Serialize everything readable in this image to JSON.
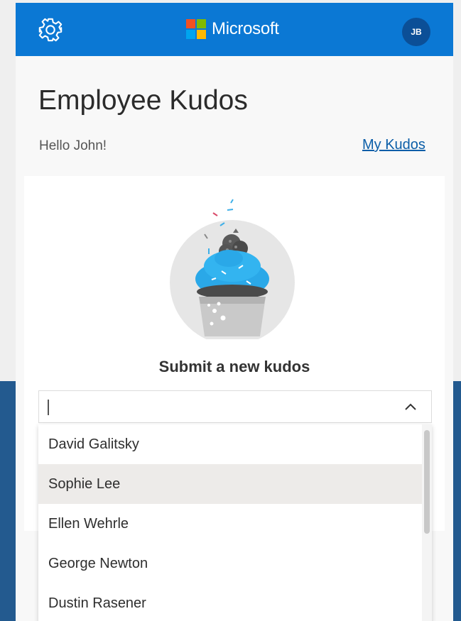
{
  "header": {
    "brand": "Microsoft",
    "avatar_initials": "JB",
    "settings_icon": "gear-icon",
    "colors": {
      "bar": "#0b78d4",
      "avatar": "#0b4f97"
    }
  },
  "page": {
    "title": "Employee Kudos",
    "greeting": "Hello John!",
    "my_kudos_link": "My Kudos"
  },
  "card": {
    "illustration": "cupcake-illustration",
    "heading": "Submit a new kudos"
  },
  "combobox": {
    "value": "",
    "placeholder": "",
    "expanded": true,
    "options": [
      "David Galitsky",
      "Sophie Lee",
      "Ellen Wehrle",
      "George Newton",
      "Dustin Rasener"
    ],
    "hovered_option": "Sophie Lee"
  }
}
